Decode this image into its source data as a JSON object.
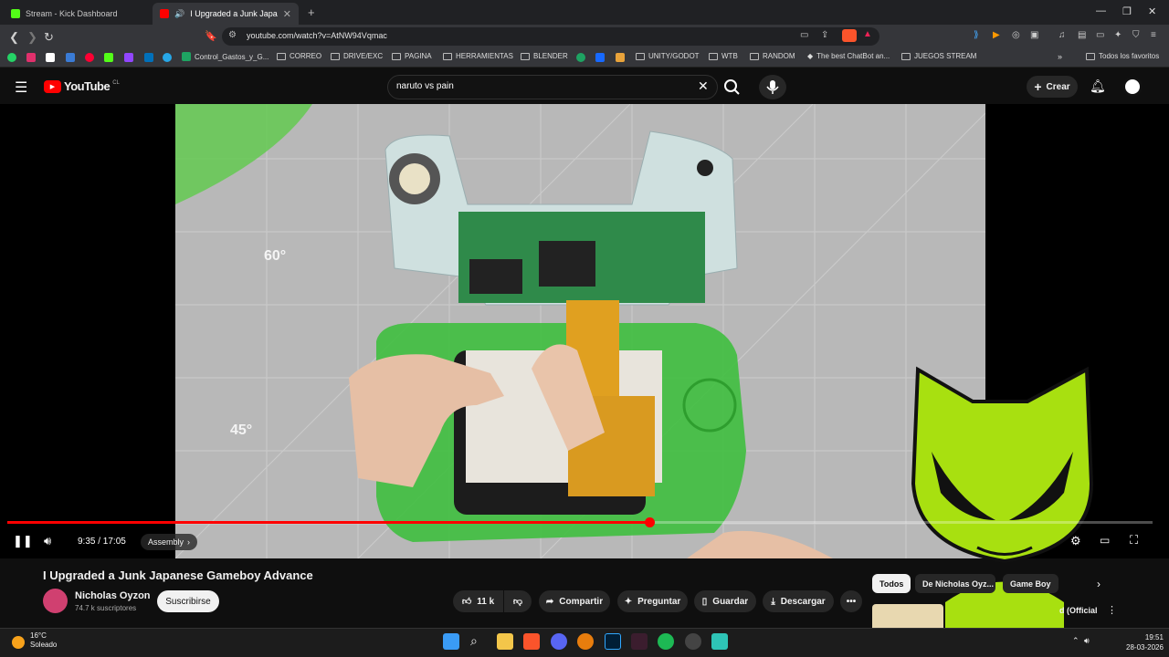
{
  "tabs": [
    {
      "label": "Stream - Kick Dashboard",
      "favicon_color": "#53fc18"
    },
    {
      "label": "I Upgraded a Junk Japanese Ga",
      "favicon_color": "#ff0000"
    }
  ],
  "address": {
    "url": "youtube.com/watch?v=AtNW94Vqmac"
  },
  "bookmarks": [
    "Control_Gastos_y_G...",
    "CORREO",
    "DRIVE/EXC",
    "PAGINA",
    "HERRAMIENTAS",
    "BLENDER",
    "UNITY/GODOT",
    "WTB",
    "RANDOM",
    "The best ChatBot an...",
    "JUEGOS STREAM"
  ],
  "bookmarks_all": "Todos los favoritos",
  "youtube": {
    "logo_text": "YouTube",
    "logo_region": "CL",
    "search_query": "naruto vs pain",
    "create_label": "Crear"
  },
  "player": {
    "time": "9:35 / 17:05",
    "chapter": "Assembly",
    "progress": 0.561,
    "frame_labels": [
      "60°",
      "45°"
    ]
  },
  "video": {
    "title": "I Upgraded a Junk Japanese Gameboy Advance",
    "channel": "Nicholas Oyzon",
    "subscribers": "74.7 k suscriptores",
    "subscribe_label": "Suscribirse",
    "likes": "11 k",
    "share": "Compartir",
    "ask": "Preguntar",
    "save": "Guardar",
    "download": "Descargar"
  },
  "chips": [
    "Todos",
    "De Nicholas Oyz...",
    "Game Boy"
  ],
  "related": {
    "partial_title": "d (Official"
  },
  "taskbar": {
    "temp": "16°C",
    "weather": "Soleado",
    "time": "19:51",
    "date": "28-03-2026"
  },
  "colors": {
    "accent_red": "#ff0000",
    "mascot_green": "#a8e010"
  }
}
